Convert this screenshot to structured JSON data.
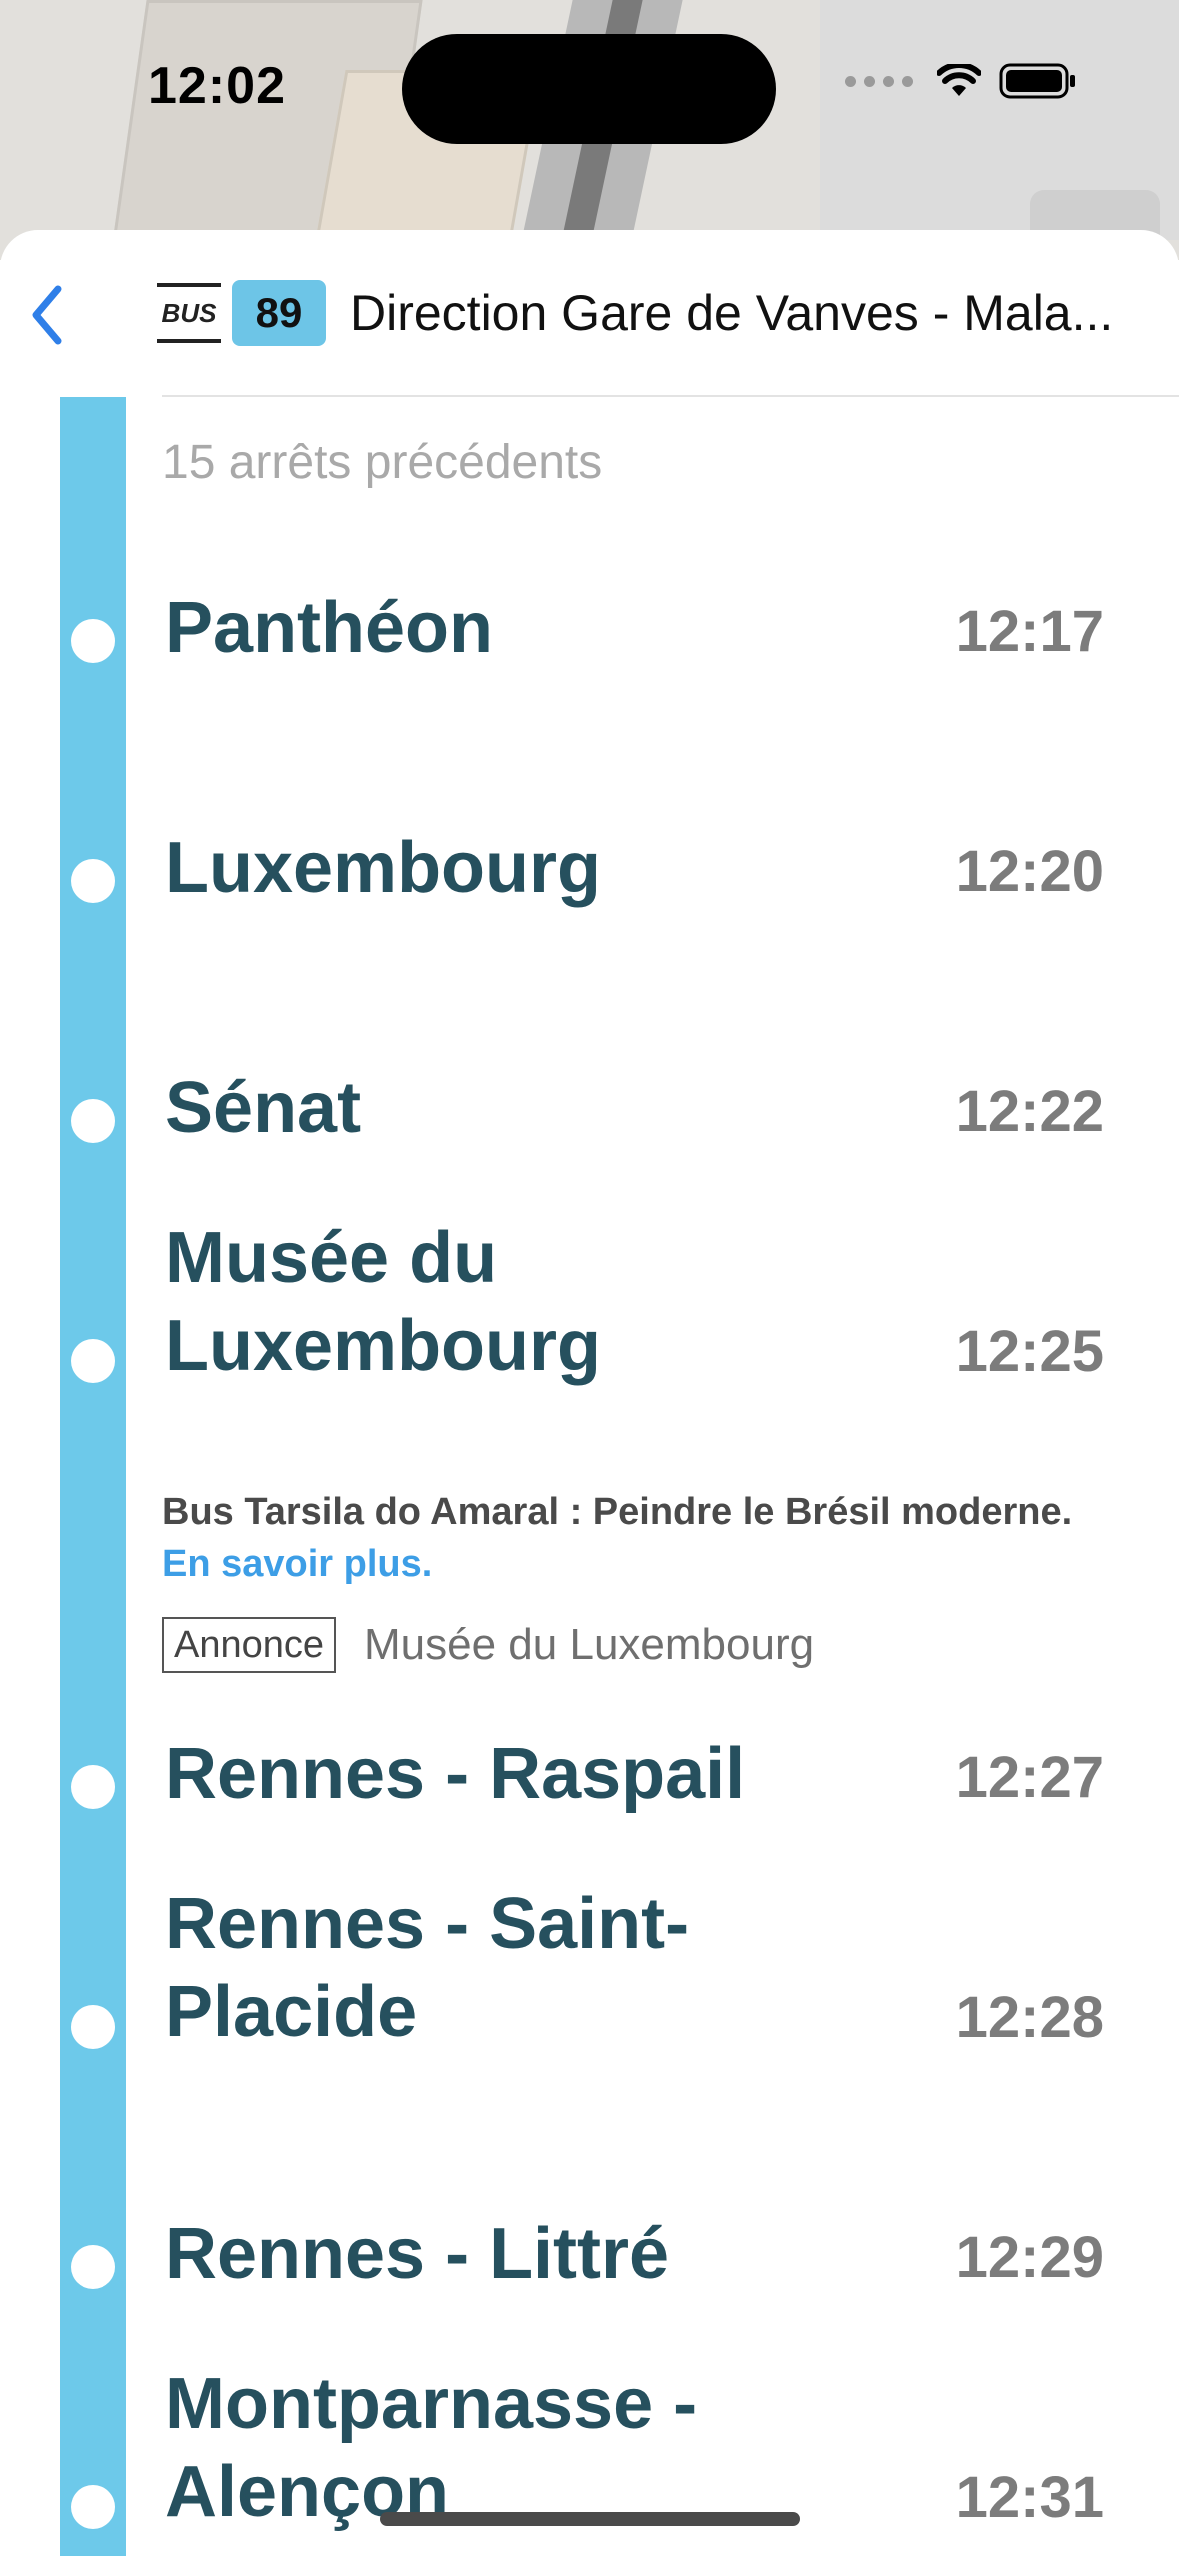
{
  "status_bar": {
    "time": "12:02"
  },
  "header": {
    "back_icon": "chevron-left-icon",
    "mode_label": "BUS",
    "line_number": "89",
    "line_color": "#6dc5e7",
    "direction": "Direction Gare de Vanves - Mala..."
  },
  "previous_stops": "15 arrêts précédents",
  "stops": [
    {
      "name": "Panthéon",
      "time": "12:17"
    },
    {
      "name": "Luxembourg",
      "time": "12:20"
    },
    {
      "name": "Sénat",
      "time": "12:22"
    },
    {
      "name": "Musée du Luxembourg",
      "time": "12:25"
    },
    {
      "name": "Rennes - Raspail",
      "time": "12:27"
    },
    {
      "name": "Rennes - Saint-Placide",
      "time": "12:28"
    },
    {
      "name": "Rennes - Littré",
      "time": "12:29"
    },
    {
      "name": "Montparnasse - Alençon",
      "time": "12:31"
    }
  ],
  "promo": {
    "text": "Bus Tarsila do Amaral : Peindre le Brésil moderne.",
    "link": "En savoir plus.",
    "ad_tag": "Annonce",
    "ad_source": "Musée du Luxembourg"
  },
  "colors": {
    "line_bar": "#6dc9ea",
    "stop_name": "#26505e",
    "link": "#3d9ee6"
  }
}
